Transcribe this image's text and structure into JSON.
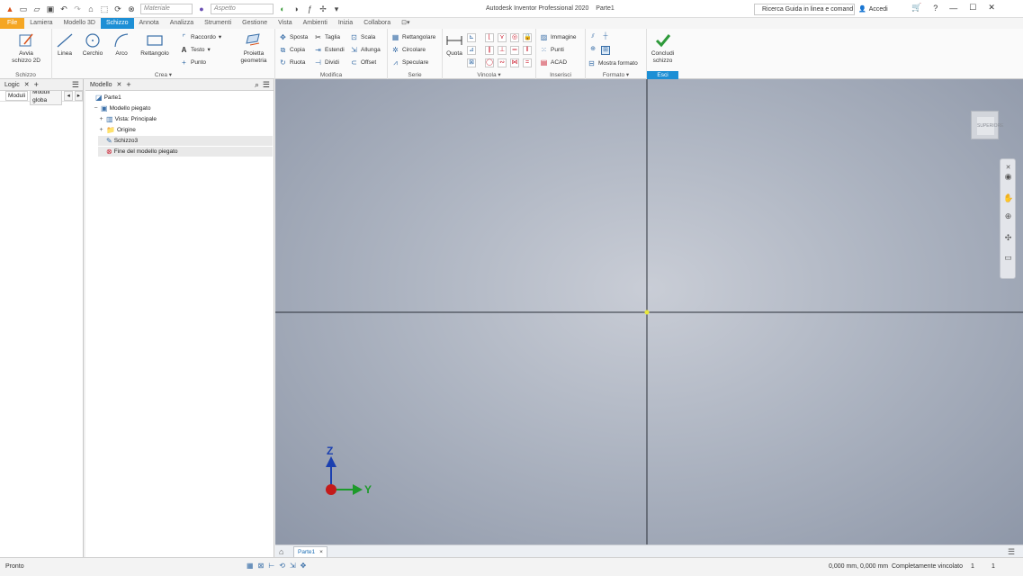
{
  "title_bar": {
    "app_title": "Autodesk Inventor Professional 2020",
    "doc_title": "Parte1",
    "material_placeholder": "Materiale",
    "appearance_placeholder": "Aspetto",
    "help_search": "Ricerca Guida in linea e comand",
    "sign_in": "Accedi",
    "help_symbol": "?"
  },
  "menu_tabs": [
    "File",
    "Lamiera",
    "Modello 3D",
    "Schizzo",
    "Annota",
    "Analizza",
    "Strumenti",
    "Gestione",
    "Vista",
    "Ambienti",
    "Inizia",
    "Collabora"
  ],
  "menu_active": "Schizzo",
  "ribbon": {
    "schizzo": {
      "start_label": "Avvia\nschizzo 2D",
      "title": "Schizzo"
    },
    "crea": {
      "linea": "Linea",
      "cerchio": "Cerchio",
      "arco": "Arco",
      "rettangolo": "Rettangolo",
      "raccordo": "Raccordo",
      "testo": "Testo",
      "punto": "Punto",
      "proietta": "Proietta\ngeometria",
      "title": "Crea"
    },
    "modifica": {
      "sposta": "Sposta",
      "copia": "Copia",
      "ruota": "Ruota",
      "taglia": "Taglia",
      "estendi": "Estendi",
      "dividi": "Dividi",
      "scala": "Scala",
      "allunga": "Allunga",
      "offset": "Offset",
      "title": "Modifica"
    },
    "serie": {
      "rettangolare": "Rettangolare",
      "circolare": "Circolare",
      "speculare": "Speculare",
      "title": "Serie"
    },
    "vincola": {
      "quota": "Quota",
      "title": "Vincola"
    },
    "inserisci": {
      "immagine": "Immagine",
      "punti": "Punti",
      "acad": "ACAD",
      "title": "Inserisci"
    },
    "formato": {
      "mostra": "Mostra formato",
      "title": "Formato"
    },
    "esci": {
      "concludi": "Concludi\nschizzo",
      "title": "Esci"
    }
  },
  "left_panel": {
    "tab_label": "Logic",
    "subtabs": [
      "Moduli",
      "Moduli globa"
    ]
  },
  "model_panel": {
    "tab_label": "Modello",
    "tree": [
      {
        "label": "Parte1",
        "level": 0,
        "expander": ""
      },
      {
        "label": "Modello piegato",
        "level": 1,
        "expander": "−"
      },
      {
        "label": "Vista: Principale",
        "level": 2,
        "expander": "+"
      },
      {
        "label": "Origine",
        "level": 2,
        "expander": "+"
      },
      {
        "label": "Schizzo3",
        "level": 2,
        "expander": ""
      },
      {
        "label": "Fine del modello piegato",
        "level": 2,
        "expander": ""
      }
    ]
  },
  "viewport": {
    "axis_z": "Z",
    "axis_y": "Y",
    "viewcube_label": "SUPERIORE",
    "colors": {
      "z_axis": "#1a3fb0",
      "y_axis": "#1d9a2a",
      "origin": "#c41a1a",
      "origin_point": "#e8e83a"
    }
  },
  "doc_tabs": {
    "active": "Parte1",
    "close": "×"
  },
  "status_bar": {
    "status": "Pronto",
    "coords": "0,000 mm, 0,000 mm",
    "constraint": "Completamente vincolato",
    "n1": "1",
    "n2": "1"
  }
}
